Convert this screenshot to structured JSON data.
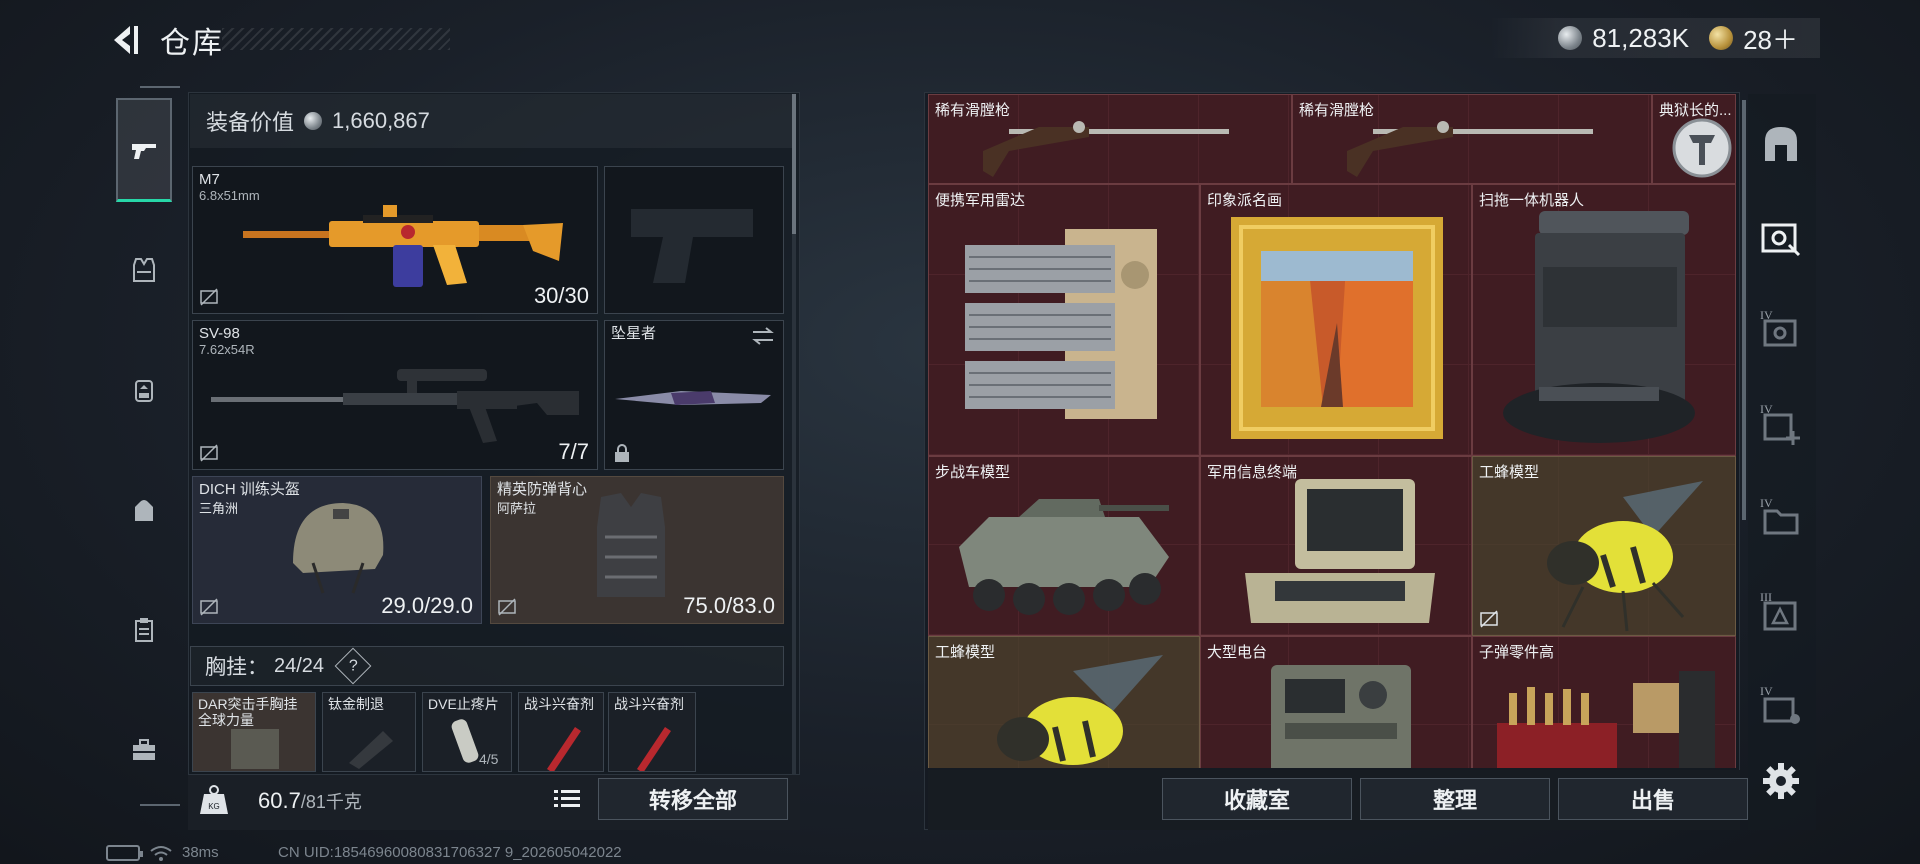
{
  "header": {
    "title": "仓库",
    "currency_silver": "81,283K",
    "currency_gold": "28＋",
    "tiny_corner_text": "---"
  },
  "left_rail": {
    "items": [
      "gun-icon",
      "body-armor-icon",
      "chest-rig-icon",
      "backpack-icon",
      "clipboard-icon",
      "toolbox-icon"
    ],
    "active_index": 0
  },
  "equipment": {
    "value_label": "装备价值",
    "value": "1,660,867",
    "primary": {
      "name": "M7",
      "caliber": "6.8x51mm",
      "ammo": "30/30"
    },
    "pistol": {
      "name": ""
    },
    "secondary": {
      "name": "SV-98",
      "caliber": "7.62x54R",
      "ammo": "7/7"
    },
    "melee": {
      "name": "坠星者"
    },
    "helmet": {
      "name": "DICH 训练头盔",
      "sub": "三角洲",
      "durability": "29.0/29.0"
    },
    "armor": {
      "name": "精英防弹背心",
      "sub": "阿萨拉",
      "durability": "75.0/83.0"
    },
    "chest_rig": {
      "label": "胸挂：",
      "count": "24/24",
      "help": "?"
    },
    "rig_items": [
      {
        "name": "DAR突击手胸挂",
        "sub": "全球力量"
      },
      {
        "name": "钛金制退"
      },
      {
        "name": "DVE止疼片",
        "sub": "4/5"
      },
      {
        "name": "战斗兴奋剂"
      },
      {
        "name": "战斗兴奋剂"
      }
    ],
    "weight": "60.7",
    "weight_max": "/81千克",
    "transfer_all": "转移全部"
  },
  "stash": {
    "items": [
      {
        "name": "稀有滑膛枪"
      },
      {
        "name": "稀有滑膛枪"
      },
      {
        "name": "典狱长的..."
      },
      {
        "name": "便携军用雷达"
      },
      {
        "name": "印象派名画"
      },
      {
        "name": "扫拖一体机器人"
      },
      {
        "name": "步战车模型"
      },
      {
        "name": "军用信息终端"
      },
      {
        "name": "工蜂模型"
      },
      {
        "name": "工蜂模型"
      },
      {
        "name": "大型电台"
      },
      {
        "name": "子弹零件高"
      }
    ],
    "buttons": {
      "collection": "收藏室",
      "organize": "整理",
      "sell": "出售"
    }
  },
  "right_rail": {
    "items": [
      "stash-icon",
      "stash-selected-icon",
      "stash-iv-icon",
      "add-stash-iv-icon",
      "stash-iv-folder-icon",
      "stash-iii-icon",
      "stash-iv-extra-icon"
    ],
    "numerals": [
      "",
      "",
      "IV",
      "IV",
      "IV",
      "III",
      "IV"
    ],
    "settings": "gear-icon"
  },
  "status_bar": {
    "ping": "38ms",
    "uid": "CN UID:18546960080831706327 9_202605042022"
  },
  "colors": {
    "accent_teal": "#27d7a8",
    "stash_maroon": "#3a1b20",
    "slot_tan": "#3b3431"
  }
}
